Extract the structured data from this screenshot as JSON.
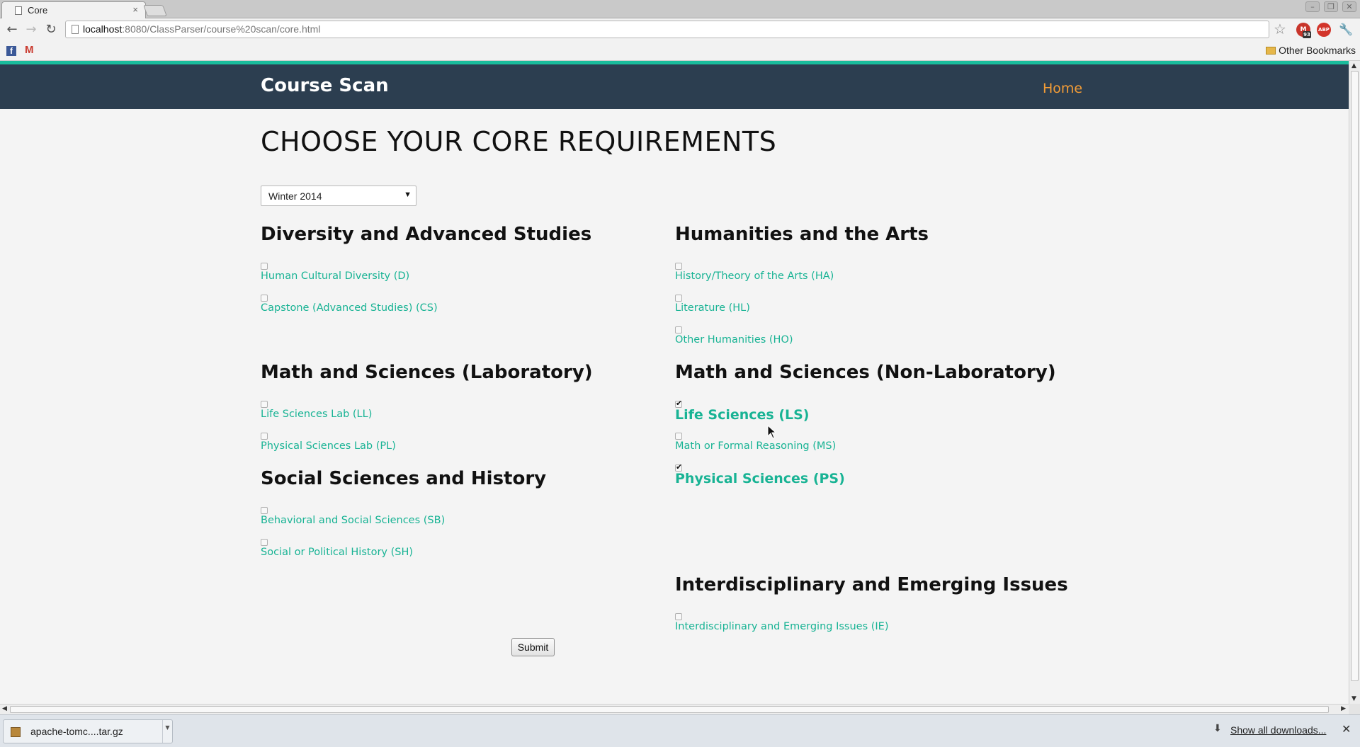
{
  "browser": {
    "tab_title": "Core",
    "tab_close": "×",
    "url_host": "localhost",
    "url_rest": ":8080/ClassParser/course%20scan/core.html",
    "other_bookmarks": "Other Bookmarks",
    "gmail_badge": "93"
  },
  "site": {
    "brand": "Course Scan",
    "nav_home": "Home"
  },
  "page": {
    "title": "CHOOSE YOUR CORE REQUIREMENTS",
    "term_selected": "Winter 2014",
    "submit": "Submit"
  },
  "sections": {
    "diversity": {
      "heading": "Diversity and Advanced Studies",
      "items": [
        {
          "label": "Human Cultural Diversity (D)",
          "checked": false
        },
        {
          "label": "Capstone (Advanced Studies) (CS)",
          "checked": false
        }
      ]
    },
    "humanities": {
      "heading": "Humanities and the Arts",
      "items": [
        {
          "label": "History/Theory of the Arts (HA)",
          "checked": false
        },
        {
          "label": "Literature (HL)",
          "checked": false
        },
        {
          "label": "Other Humanities (HO)",
          "checked": false
        }
      ]
    },
    "math_lab": {
      "heading": "Math and Sciences (Laboratory)",
      "items": [
        {
          "label": "Life Sciences Lab (LL)",
          "checked": false
        },
        {
          "label": "Physical Sciences Lab (PL)",
          "checked": false
        }
      ]
    },
    "math_nonlab": {
      "heading": "Math and Sciences (Non-Laboratory)",
      "items": [
        {
          "label": "Life Sciences (LS)",
          "checked": true
        },
        {
          "label": "Math or Formal Reasoning (MS)",
          "checked": false
        },
        {
          "label": "Physical Sciences (PS)",
          "checked": true
        }
      ]
    },
    "social": {
      "heading": "Social Sciences and History",
      "items": [
        {
          "label": "Behavioral and Social Sciences (SB)",
          "checked": false
        },
        {
          "label": "Social or Political History (SH)",
          "checked": false
        }
      ]
    },
    "interdisciplinary": {
      "heading": "Interdisciplinary and Emerging Issues",
      "items": [
        {
          "label": "Interdisciplinary and Emerging Issues (IE)",
          "checked": false
        }
      ]
    }
  },
  "downloads": {
    "file_name": "apache-tomc....tar.gz",
    "show_all": "Show all downloads..."
  }
}
